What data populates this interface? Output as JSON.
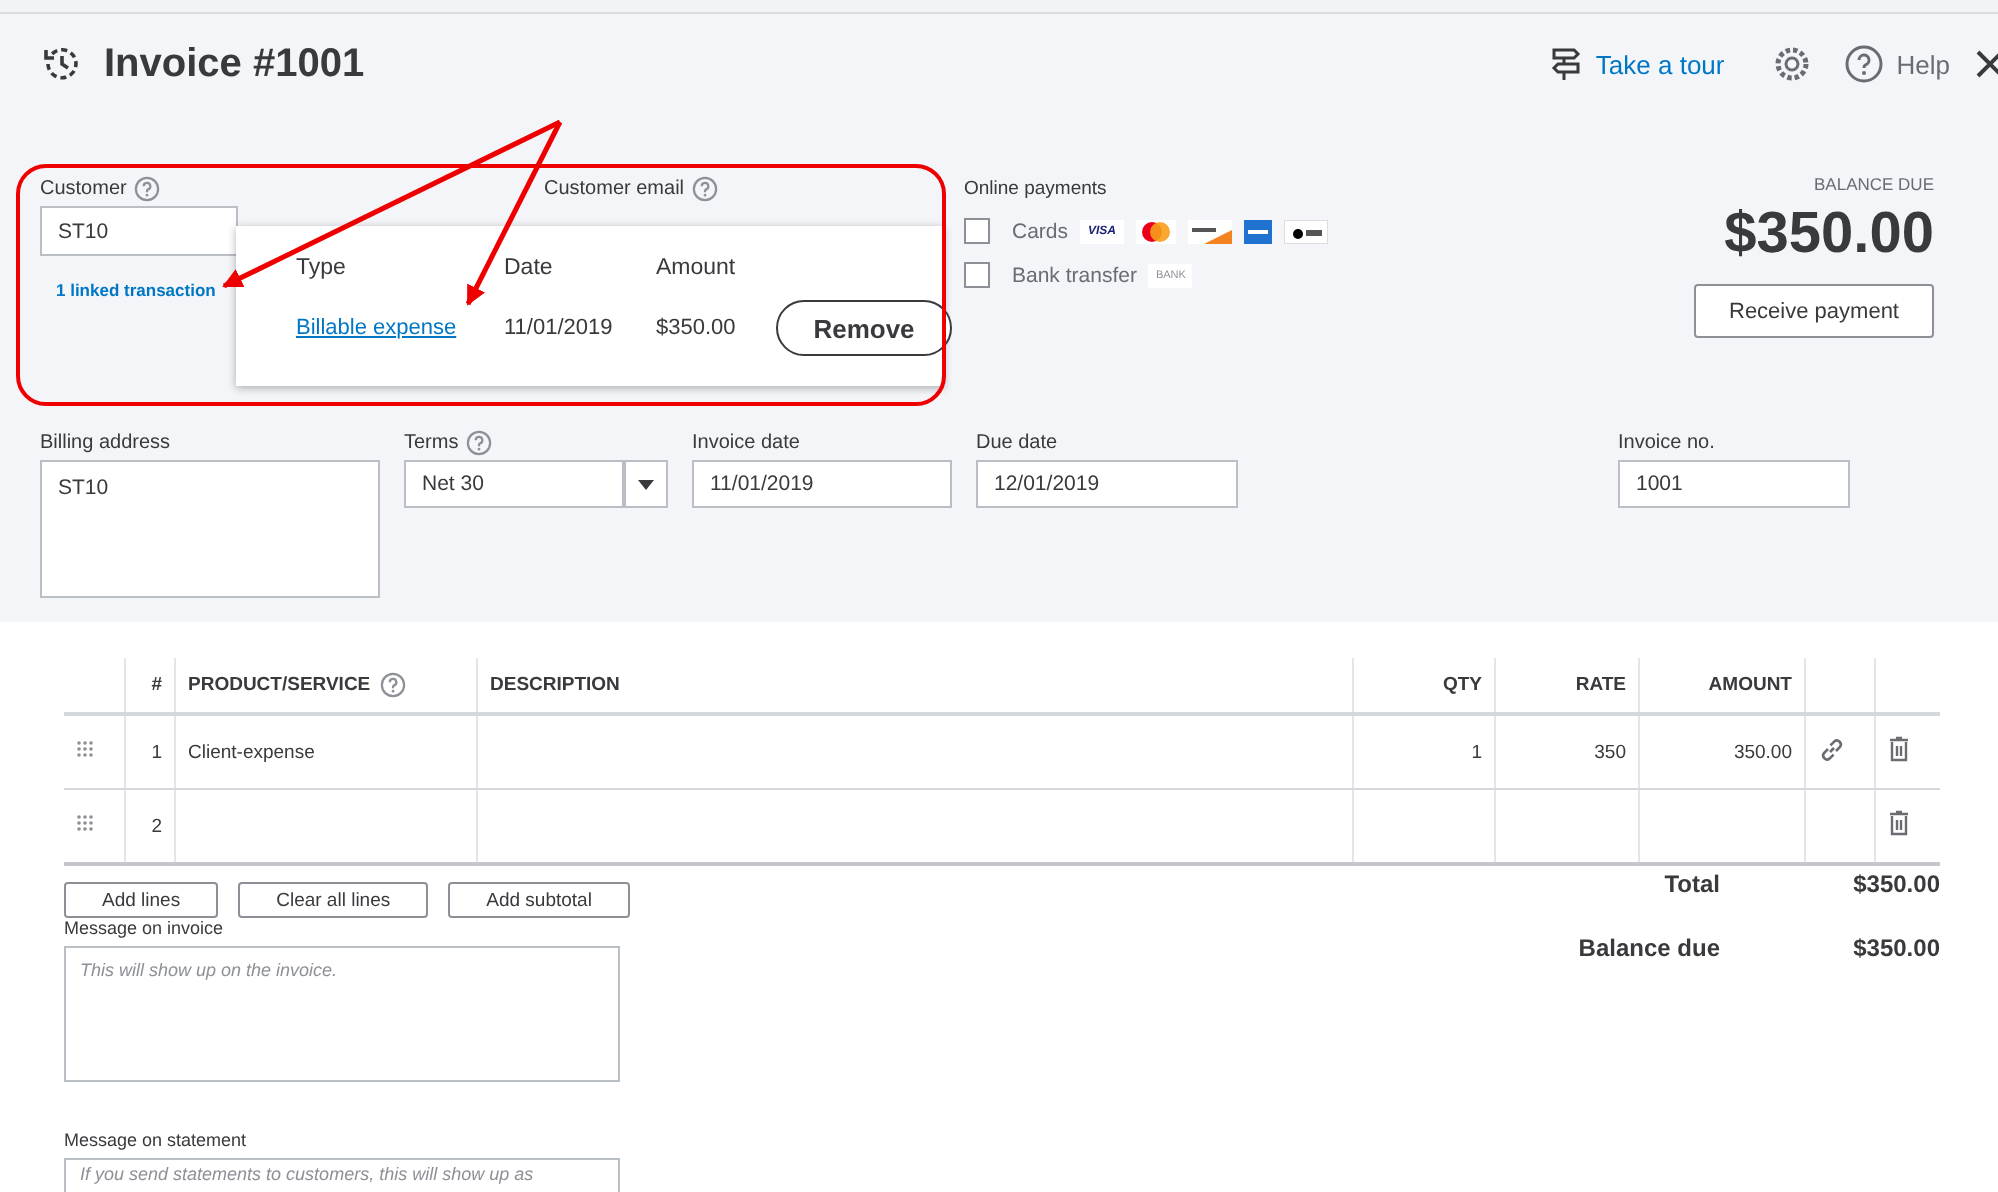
{
  "header": {
    "title": "Invoice #1001",
    "tour": "Take a tour",
    "help": "Help"
  },
  "customer": {
    "label": "Customer",
    "value": "ST10",
    "linked": "1 linked transaction"
  },
  "email": {
    "label": "Customer email"
  },
  "popover": {
    "columns": [
      "Type",
      "Date",
      "Amount"
    ],
    "rows": [
      {
        "type": "Billable expense",
        "date": "11/01/2019",
        "amount": "$350.00"
      }
    ],
    "button": "Remove"
  },
  "online_payments": {
    "title": "Online payments",
    "options": [
      {
        "label": "Cards",
        "checked": false,
        "logos": [
          {
            "kind": "text",
            "text": "VISA"
          },
          {
            "kind": "mastercard"
          },
          {
            "kind": "discover"
          },
          {
            "kind": "amex"
          },
          {
            "kind": "applepay"
          }
        ]
      },
      {
        "label": "Bank transfer",
        "checked": false,
        "logos": [
          {
            "kind": "text",
            "text": "BANK"
          }
        ]
      }
    ]
  },
  "balance": {
    "label": "BALANCE DUE",
    "amount": "$350.00",
    "button": "Receive payment"
  },
  "billing": {
    "label": "Billing address",
    "value": "ST10"
  },
  "terms": {
    "label": "Terms",
    "value": "Net 30"
  },
  "invoice_date": {
    "label": "Invoice date",
    "value": "11/01/2019"
  },
  "due_date": {
    "label": "Due date",
    "value": "12/01/2019"
  },
  "invoice_no": {
    "label": "Invoice no.",
    "value": "1001"
  },
  "table": {
    "columns": [
      "#",
      "PRODUCT/SERVICE",
      "DESCRIPTION",
      "QTY",
      "RATE",
      "AMOUNT"
    ],
    "rows": [
      {
        "num": "1",
        "product": "Client-expense",
        "qty": "1",
        "rate": "350",
        "amount": "350.00",
        "linked": true
      },
      {
        "num": "2",
        "linked": false
      }
    ]
  },
  "buttons": [
    "Add lines",
    "Clear all lines",
    "Add subtotal"
  ],
  "totals": [
    {
      "label": "Total",
      "value": "$350.00"
    },
    {
      "label": "Balance due",
      "value": "$350.00"
    }
  ],
  "messages": [
    {
      "label": "Message on invoice",
      "placeholder": "This will show up on the invoice."
    },
    {
      "label": "Message on statement",
      "placeholder": "If you send statements to customers, this will show up as"
    }
  ]
}
